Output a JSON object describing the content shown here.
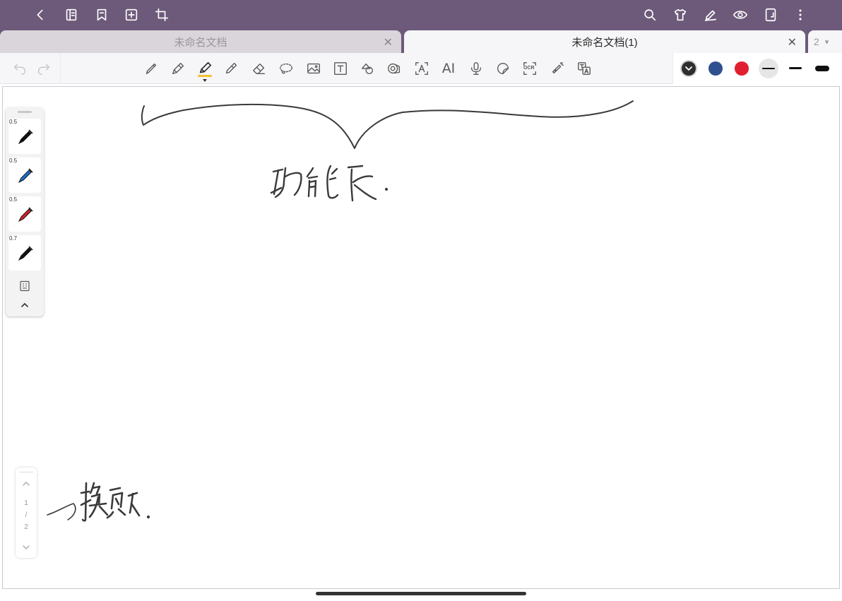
{
  "topbar": {
    "background": "#6d5a7a",
    "left_icons": [
      "back-icon",
      "sidebar-panel-icon",
      "bookmark-icon",
      "add-page-icon",
      "crop-icon"
    ],
    "right_icons": [
      "search-icon",
      "theme-shirt-icon",
      "pen-edit-icon",
      "eye-icon",
      "layout-icon",
      "more-icon"
    ]
  },
  "tabs": {
    "items": [
      {
        "label": "未命名文档",
        "active": false
      },
      {
        "label": "未命名文档(1)",
        "active": true
      }
    ],
    "close_glyph": "✕",
    "more_label": "2",
    "more_glyph": "▾"
  },
  "toolbar": {
    "tools": [
      "pencil-icon",
      "fountain-pen-icon",
      "highlighter-pen-icon",
      "marker-icon",
      "eraser-icon",
      "lasso-icon",
      "image-icon",
      "text-box-icon",
      "shape-icon",
      "tape-icon",
      "text-recognition-icon",
      "ai-icon",
      "microphone-icon",
      "sticker-icon",
      "ocr-icon",
      "laser-pointer-icon",
      "translate-icon"
    ],
    "ai_label": "AI",
    "ocr_label": "OCR",
    "active_tool_accent": "#f2c230",
    "colors": [
      "#2e2e2e",
      "#2f4f8f",
      "#e02030"
    ]
  },
  "pen_panel": {
    "pens": [
      {
        "size": "0.5",
        "color": "#111111"
      },
      {
        "size": "0.5",
        "color": "#1f6fd1"
      },
      {
        "size": "0.5",
        "color": "#d1222a"
      },
      {
        "size": "0.7",
        "color": "#111111"
      }
    ]
  },
  "pager": {
    "current": "1",
    "separator": "/",
    "total": "2"
  },
  "handwriting": {
    "annotation_1": "功能区.",
    "annotation_2": "换页"
  }
}
